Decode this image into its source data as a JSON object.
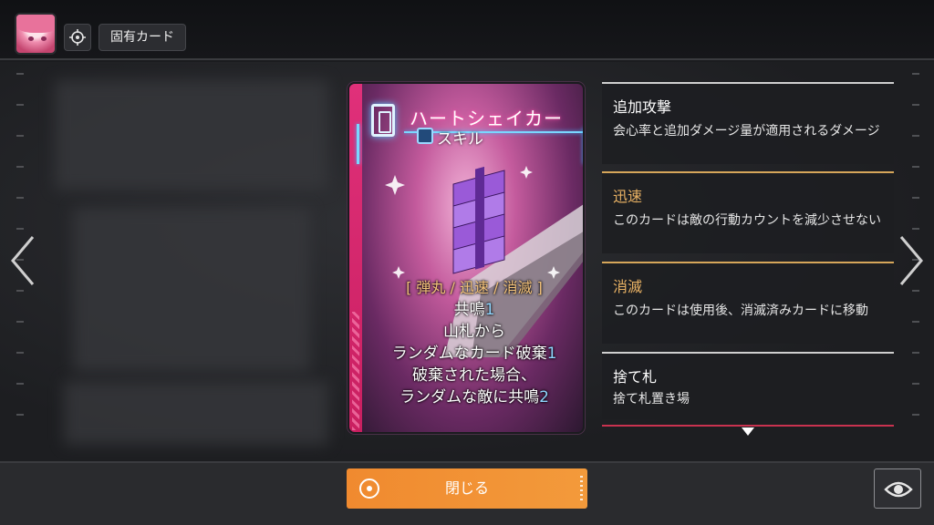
{
  "header": {
    "avatar_icon": "character-portrait",
    "target_icon": "target-icon",
    "tag_label": "固有カード"
  },
  "card": {
    "name": "ハートシェイカー",
    "type": "スキル",
    "keywords_line": "[ 弾丸 / 迅速 / 消滅 ]",
    "effect_lines": [
      {
        "text": "共鳴",
        "num": "1"
      },
      {
        "text": "山札から",
        "num": ""
      },
      {
        "text": "ランダムなカード破棄",
        "num": "1"
      },
      {
        "text": "破棄された場合、",
        "num": ""
      },
      {
        "text": "ランダムな敵に共鳴",
        "num": "2"
      }
    ],
    "accent_color": "#e0307a"
  },
  "glossary": [
    {
      "title": "追加攻撃",
      "desc": "会心率と追加ダメージ量が適用されるダメージ"
    },
    {
      "title": "迅速",
      "desc": "このカードは敵の行動カウントを減少させない"
    },
    {
      "title": "消滅",
      "desc": "このカードは使用後、消滅済みカードに移動"
    },
    {
      "title": "捨て札",
      "desc": "捨て札置き場"
    }
  ],
  "footer": {
    "close_label": "閉じる",
    "close_color": "#f08a2f",
    "eye_icon": "eye-icon"
  },
  "nav": {
    "prev_icon": "chevron-left-icon",
    "next_icon": "chevron-right-icon"
  }
}
